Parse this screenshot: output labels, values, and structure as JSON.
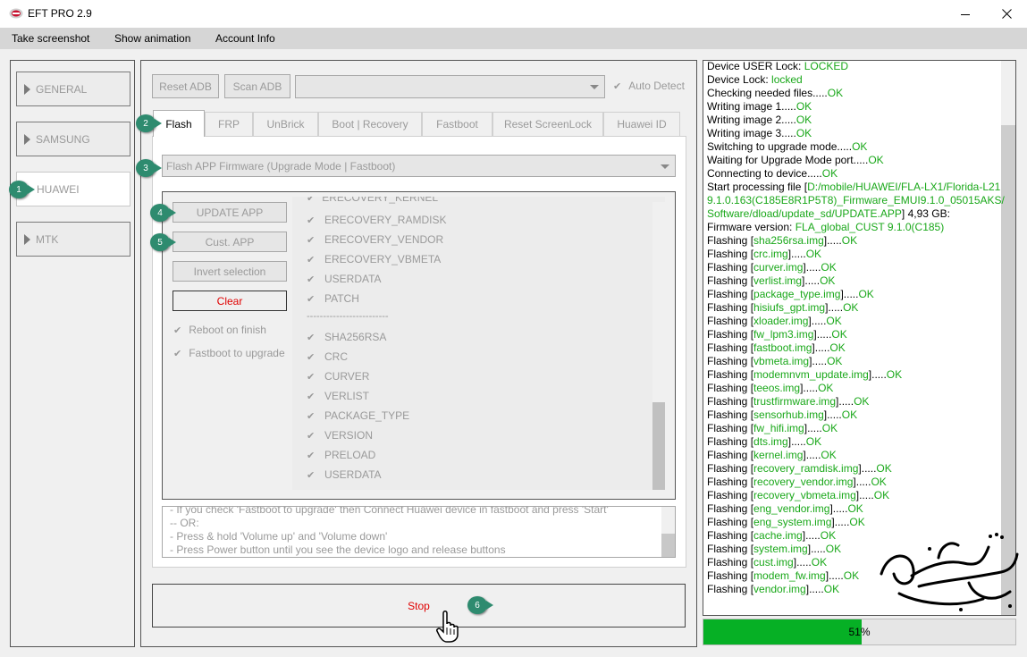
{
  "window": {
    "title": "EFT PRO 2.9"
  },
  "menu": [
    "Take screenshot",
    "Show animation",
    "Account Info"
  ],
  "sidebar": [
    {
      "label": "GENERAL",
      "active": false
    },
    {
      "label": "SAMSUNG",
      "active": false
    },
    {
      "label": "HUAWEI",
      "active": true
    },
    {
      "label": "MTK",
      "active": false
    }
  ],
  "toolbar": {
    "reset_adb": "Reset ADB",
    "scan_adb": "Scan ADB",
    "port_value": "",
    "auto_detect": "Auto Detect"
  },
  "tabs": [
    "Flash",
    "FRP",
    "UnBrick",
    "Boot | Recovery",
    "Fastboot",
    "Reset ScreenLock",
    "Huawei ID"
  ],
  "flash": {
    "mode_select": "Flash APP Firmware (Upgrade Mode | Fastboot)",
    "update_app": "UPDATE APP",
    "cust_app": "Cust. APP",
    "invert_selection": "Invert selection",
    "clear": "Clear",
    "reboot_on_finish": "Reboot on finish",
    "fastboot_to_upgrade": "Fastboot to upgrade",
    "partitions_top_cut": "ERECOVERY_KERNEL",
    "partitions_a": [
      "ERECOVERY_RAMDISK",
      "ERECOVERY_VENDOR",
      "ERECOVERY_VBMETA",
      "USERDATA",
      "PATCH"
    ],
    "separator": "-------------------------",
    "partitions_b": [
      "SHA256RSA",
      "CRC",
      "CURVER",
      "VERLIST",
      "PACKAGE_TYPE",
      "VERSION",
      "PRELOAD",
      "USERDATA"
    ],
    "info_lines": [
      "- If you check 'Fastboot to upgrade' then Connect Huawei device in fastboot and press 'Start'",
      "-- OR:",
      "- Press & hold 'Volume up' and 'Volume down'",
      "- Press Power button until you see the device logo and release buttons"
    ],
    "stop": "Stop"
  },
  "badges": [
    "1",
    "2",
    "3",
    "4",
    "5",
    "6"
  ],
  "log": [
    {
      "t": "Device USER Lock: ",
      "g": "LOCKED"
    },
    {
      "t": "Device Lock: ",
      "g": "locked"
    },
    {
      "t": "Checking needed files.....",
      "g": "OK"
    },
    {
      "t": "Writing image 1.....",
      "g": "OK"
    },
    {
      "t": "Writing image 2.....",
      "g": "OK"
    },
    {
      "t": "Writing image 3.....",
      "g": "OK"
    },
    {
      "t": "Switching to upgrade mode.....",
      "g": "OK"
    },
    {
      "t": "Waiting for Upgrade Mode port.....",
      "g": "OK"
    },
    {
      "t": "Connecting to device.....",
      "g": "OK"
    }
  ],
  "log_processing": {
    "prefix": "Start processing file [",
    "path1": "D:/mobile/HUAWEI/FLA-LX1/Florida-L21",
    "path2": "9.1.0.163(C185E8R1P5T8)_Firmware_EMUI9.1.0_05015AKS/",
    "path3": "Software/dload/update_sd/UPDATE.APP",
    "suffix": "] 4,93 GB:",
    "fw_label": "Firmware version: ",
    "fw_value": "FLA_global_CUST 9.1.0(C185)"
  },
  "flashing_files": [
    "sha256rsa.img",
    "crc.img",
    "curver.img",
    "verlist.img",
    "package_type.img",
    "hisiufs_gpt.img",
    "xloader.img",
    "fw_lpm3.img",
    "fastboot.img",
    "vbmeta.img",
    "modemnvm_update.img",
    "teeos.img",
    "trustfirmware.img",
    "sensorhub.img",
    "fw_hifi.img",
    "dts.img",
    "kernel.img",
    "recovery_ramdisk.img",
    "recovery_vendor.img",
    "recovery_vbmeta.img",
    "eng_vendor.img",
    "eng_system.img",
    "cache.img",
    "system.img",
    "cust.img",
    "modem_fw.img",
    "vendor.img"
  ],
  "flashing_word": "Flashing",
  "ok_text": "OK",
  "dots": ".....",
  "progress": {
    "percent": 51,
    "label": "51%"
  },
  "colors": {
    "accent_green": "#1aa81a",
    "progress_green": "#06b025",
    "badge": "#2e8b6f",
    "clear_red": "#e00000"
  }
}
